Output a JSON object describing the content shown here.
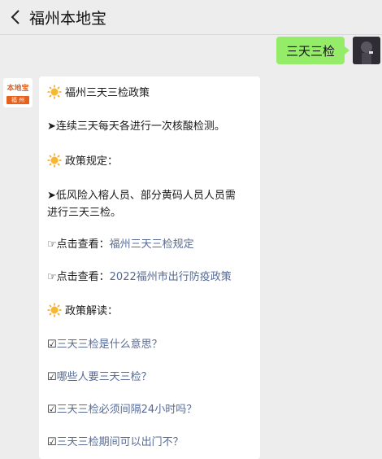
{
  "header": {
    "title": "福州本地宝"
  },
  "right_message": {
    "text": "三天三检"
  },
  "avatar_left": {
    "logo_text": "本地宝",
    "logo_city": "福 州"
  },
  "card": {
    "heading_policy": "福州三天三检政策",
    "policy_line": "➤连续三天每天各进行一次核酸检测。",
    "heading_rules": "政策规定：",
    "rules_line_1": "➤低风险入榕人员、部分黄码人员人员需",
    "rules_line_2": "进行三天三检。",
    "view_prefix_1": "☞点击查看：",
    "view_link_1": "福州三天三检规定",
    "view_prefix_2": "☞点击查看：",
    "view_link_2": "2022福州市出行防疫政策",
    "heading_interpret": "政策解读：",
    "q1_prefix": "☑",
    "q1": "三天三检是什么意思？",
    "q2_prefix": "☑",
    "q2": "哪些人要三天三检？",
    "q3_prefix": "☑",
    "q3": "三天三检必须间隔24小时吗？",
    "q4_prefix": "☑",
    "q4": "三天三检期间可以出门不？"
  },
  "colors": {
    "bubble_green": "#95ec69",
    "link": "#576b95",
    "brand_orange": "#e8611c"
  }
}
